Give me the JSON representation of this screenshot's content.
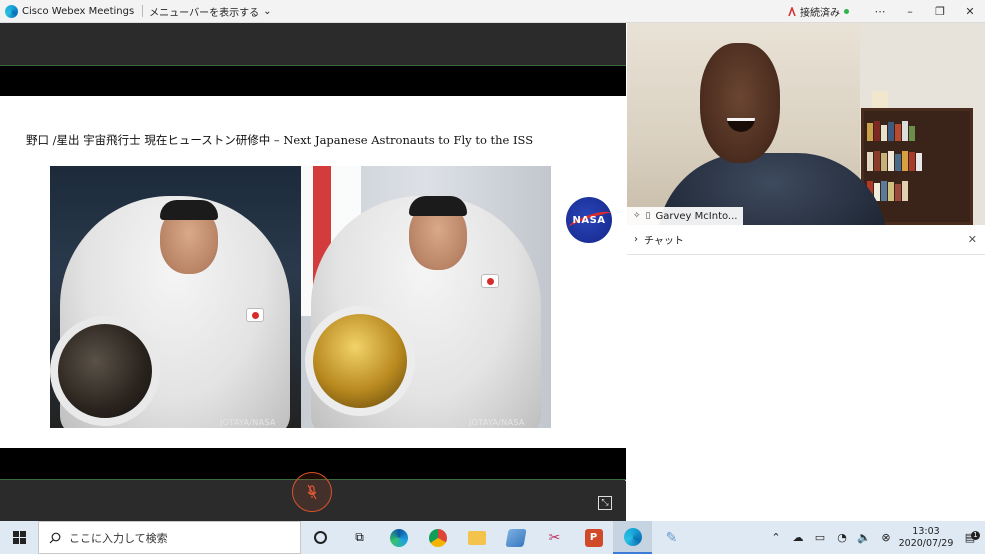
{
  "window": {
    "app_name": "Cisco Webex Meetings",
    "menu_label": "メニューバーを表示する",
    "status_label": "接続済み",
    "status_color": "#2fb24a"
  },
  "slide": {
    "title": "野口 /星出 宇宙飛行士 現在ヒューストン研修中 – Next Japanese Astronauts to Fly to the ISS",
    "credit_left": "JOTAYA/NASA",
    "credit_right": "JOTAYA/NASA",
    "logo_text": "NASA"
  },
  "participant": {
    "name": "Garvey McInto..."
  },
  "chat": {
    "label": "チャット"
  },
  "taskbar": {
    "search_placeholder": "ここに入力して検索",
    "time": "13:03",
    "date": "2020/07/29",
    "notification_count": "1"
  }
}
